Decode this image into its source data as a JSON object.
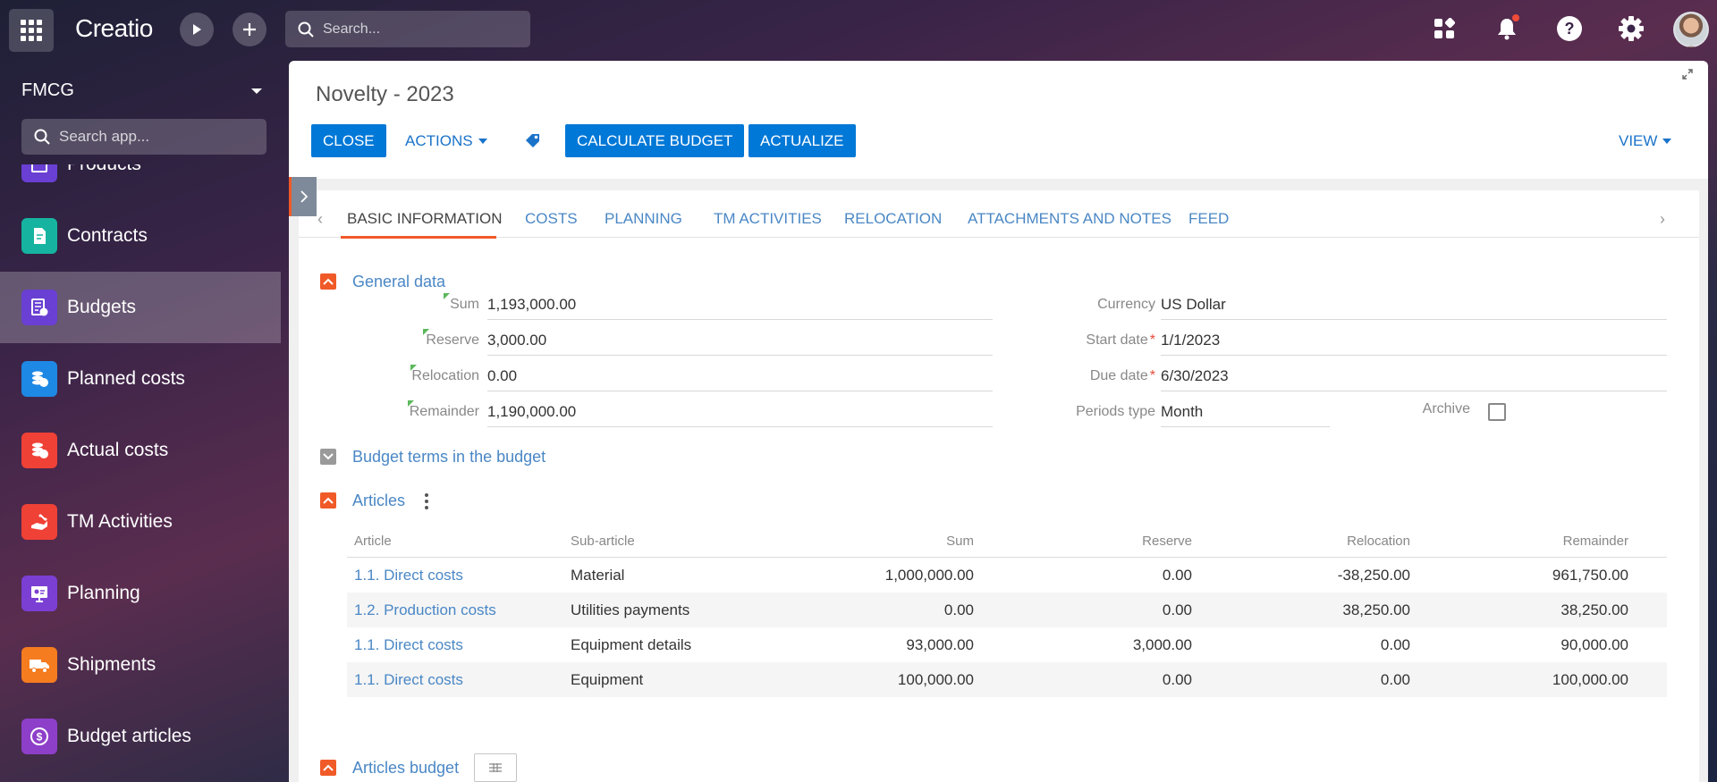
{
  "topbar": {
    "logo": "Creatio",
    "search_placeholder": "Search..."
  },
  "sidebar": {
    "workspace": "FMCG",
    "search_placeholder": "Search app...",
    "items": [
      {
        "label": "Products",
        "icon": "products-icon",
        "color": "#6a3fd3"
      },
      {
        "label": "Contracts",
        "icon": "contract-icon",
        "color": "#16b3a0"
      },
      {
        "label": "Budgets",
        "icon": "budget-icon",
        "color": "#6a3fd3",
        "active": true
      },
      {
        "label": "Planned costs",
        "icon": "planned-costs-icon",
        "color": "#1e88e5"
      },
      {
        "label": "Actual costs",
        "icon": "actual-costs-icon",
        "color": "#ef4136"
      },
      {
        "label": "TM Activities",
        "icon": "tm-activities-icon",
        "color": "#ef4136"
      },
      {
        "label": "Planning",
        "icon": "planning-icon",
        "color": "#7b3fd3"
      },
      {
        "label": "Shipments",
        "icon": "shipments-icon",
        "color": "#f57c1f"
      },
      {
        "label": "Budget articles",
        "icon": "budget-articles-icon",
        "color": "#8e3fc9"
      }
    ]
  },
  "page": {
    "title": "Novelty - 2023",
    "buttons": {
      "close": "CLOSE",
      "actions": "ACTIONS",
      "calculate": "CALCULATE BUDGET",
      "actualize": "ACTUALIZE",
      "view": "VIEW"
    },
    "tabs": [
      "BASIC INFORMATION",
      "COSTS",
      "PLANNING",
      "TM ACTIVITIES",
      "RELOCATION",
      "ATTACHMENTS AND NOTES",
      "FEED"
    ]
  },
  "general": {
    "title": "General data",
    "sum_label": "Sum",
    "sum": "1,193,000.00",
    "reserve_label": "Reserve",
    "reserve": "3,000.00",
    "relocation_label": "Relocation",
    "relocation": "0.00",
    "remainder_label": "Remainder",
    "remainder": "1,190,000.00",
    "currency_label": "Currency",
    "currency": "US Dollar",
    "start_label": "Start date",
    "start": "1/1/2023",
    "due_label": "Due date",
    "due": "6/30/2023",
    "periods_label": "Periods type",
    "periods": "Month",
    "archive_label": "Archive"
  },
  "budget_terms": {
    "title": "Budget terms in the budget"
  },
  "articles": {
    "title": "Articles",
    "headers": [
      "Article",
      "Sub-article",
      "Sum",
      "Reserve",
      "Relocation",
      "Remainder"
    ],
    "rows": [
      [
        "1.1. Direct costs",
        "Material",
        "1,000,000.00",
        "0.00",
        "-38,250.00",
        "961,750.00"
      ],
      [
        "1.2. Production costs",
        "Utilities payments",
        "0.00",
        "0.00",
        "38,250.00",
        "38,250.00"
      ],
      [
        "1.1. Direct costs",
        "Equipment details",
        "93,000.00",
        "3,000.00",
        "0.00",
        "90,000.00"
      ],
      [
        "1.1. Direct costs",
        "Equipment",
        "100,000.00",
        "0.00",
        "0.00",
        "100,000.00"
      ]
    ]
  },
  "articles_budget": {
    "title": "Articles budget"
  }
}
